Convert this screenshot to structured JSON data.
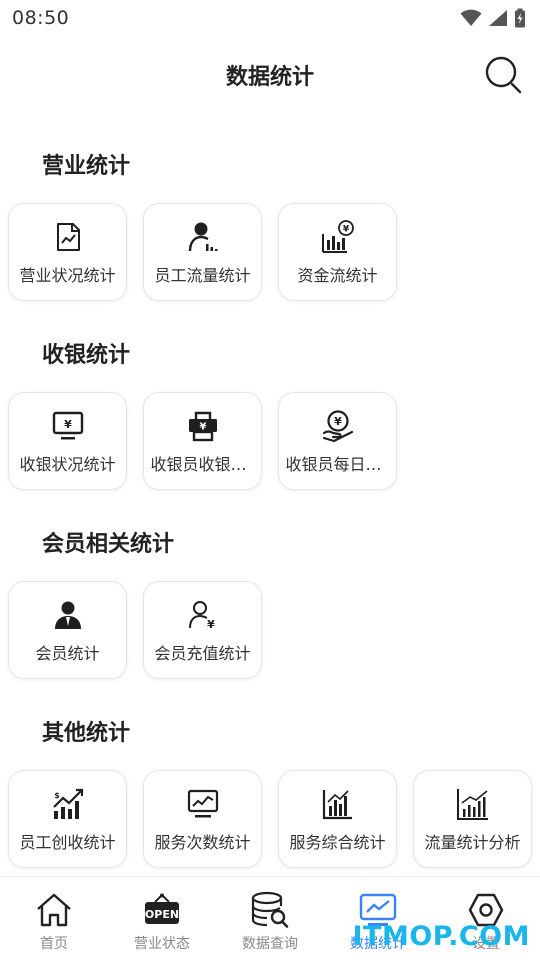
{
  "status_bar": {
    "time": "08:50"
  },
  "app_bar": {
    "title": "数据统计"
  },
  "sections": {
    "business": {
      "title": "营业统计",
      "items": [
        "营业状况统计",
        "员工流量统计",
        "资金流统计"
      ]
    },
    "cashier": {
      "title": "收银统计",
      "items": [
        "收银状况统计",
        "收银员收银统计",
        "收银员每日统计"
      ]
    },
    "member": {
      "title": "会员相关统计",
      "items": [
        "会员统计",
        "会员充值统计"
      ]
    },
    "other": {
      "title": "其他统计",
      "items": [
        "员工创收统计",
        "服务次数统计",
        "服务综合统计",
        "流量统计分析"
      ]
    }
  },
  "tab_bar": {
    "home": "首页",
    "business_status": "营业状态",
    "data_query": "数据查询",
    "data_stats": "数据统计",
    "settings": "设置",
    "open_sign": "OPEN"
  },
  "watermark": "ITMOP.COM",
  "colors": {
    "accent": "#3b82f6",
    "icon": "#1f1f1f",
    "watermark": "#19b6ec"
  }
}
